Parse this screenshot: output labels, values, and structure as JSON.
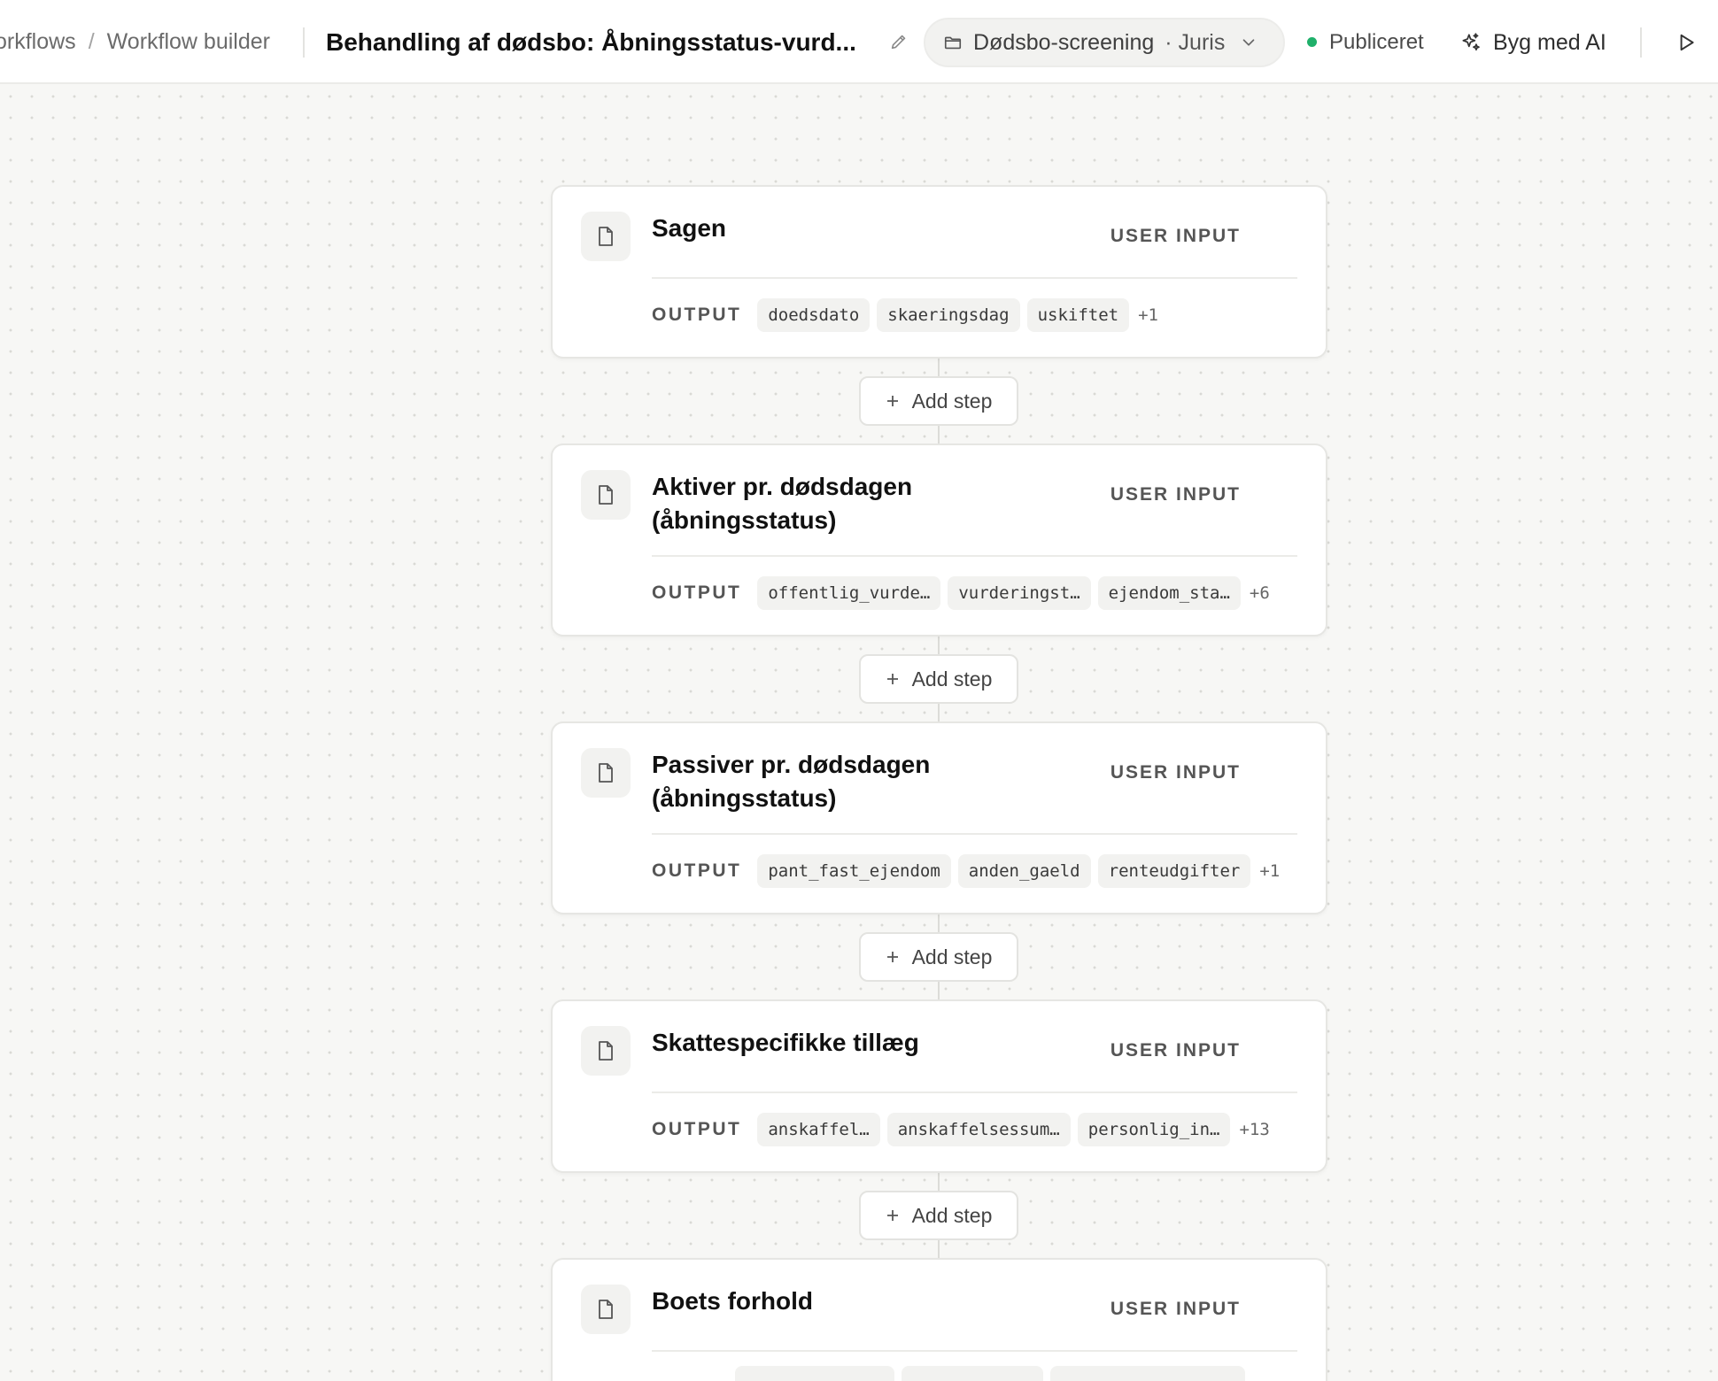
{
  "breadcrumb": {
    "parent": "orkflows",
    "separator": "/",
    "current": "Workflow builder"
  },
  "workflow": {
    "title": "Behandling af dødsbo: Åbningsstatus-vurd...",
    "folder_name": "Dødsbo-screening",
    "folder_meta": "· Juris",
    "status": "Publiceret",
    "status_color": "#1fb06a",
    "ai_button_label": "Byg med AI"
  },
  "icons": {
    "edit": "pencil-icon",
    "folder": "folder-icon",
    "chevron": "chevron-down-icon",
    "ai": "sparkles-icon",
    "run": "play-icon",
    "step": "document-icon",
    "add": "plus-icon"
  },
  "add_step_label": "Add step",
  "output_label": "OUTPUT",
  "steps": [
    {
      "title": "Sagen",
      "type": "USER INPUT",
      "outputs": [
        "doedsdato",
        "skaeringsdag",
        "uskiftet"
      ],
      "more": "+1"
    },
    {
      "title": "Aktiver pr. dødsdagen (åbningsstatus)",
      "type": "USER INPUT",
      "outputs": [
        "offentlig_vurde…",
        "vurderingst…",
        "ejendom_sta…"
      ],
      "more": "+6"
    },
    {
      "title": "Passiver pr. dødsdagen (åbningsstatus)",
      "type": "USER INPUT",
      "outputs": [
        "pant_fast_ejendom",
        "anden_gaeld",
        "renteudgifter"
      ],
      "more": "+1"
    },
    {
      "title": "Skattespecifikke tillæg",
      "type": "USER INPUT",
      "outputs": [
        "anskaffel…",
        "anskaffelsessum…",
        "personlig_in…"
      ],
      "more": "+13"
    },
    {
      "title": "Boets forhold",
      "type": "USER INPUT",
      "outputs": [
        "",
        "",
        ""
      ],
      "more": ""
    }
  ]
}
